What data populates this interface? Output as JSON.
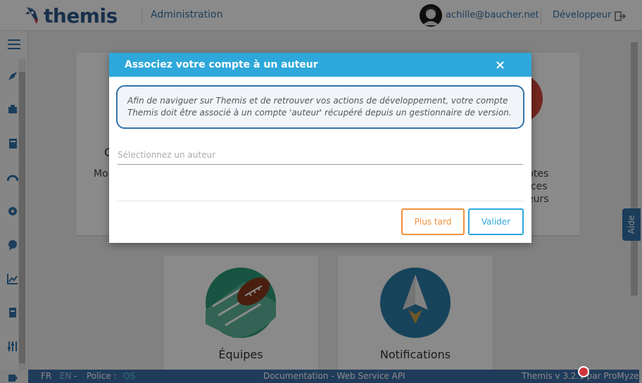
{
  "header": {
    "brand": "themis",
    "section": "Administration",
    "user_email": "achille@baucher.net",
    "profile": "Développeur"
  },
  "sidebar": {
    "icons": [
      "menu-icon",
      "rocket-icon",
      "developer-icon",
      "book-icon",
      "gauge-icon",
      "settings-icon",
      "chat-icon",
      "chart-icon",
      "document-icon",
      "sliders-icon",
      "puzzle-icon"
    ]
  },
  "background_cards": {
    "partial_left_title": "C",
    "partial_left_text": "Mo",
    "partial_right_lines": [
      "ptes",
      "ources",
      "eurs"
    ],
    "teams": "Équipes",
    "notifications": "Notifications"
  },
  "help_tab": "Aide",
  "footer": {
    "lang_fr": "FR",
    "lang_en": "EN",
    "sep1": "-",
    "police_label": "Police :",
    "police_value": "QS",
    "links": "Documentation - Web Service API",
    "version": "Themis v 3.2.1 par ProMyze"
  },
  "modal": {
    "title": "Associez votre compte à un auteur",
    "close": "×",
    "info": "Afin de naviguer sur Themis et de retrouver vos actions de développement, votre compte Themis doit être associé à un compte 'auteur' récupéré depuis un gestionnaire de version.",
    "select_placeholder": "Sélectionnez un auteur",
    "later_button": "Plus tard",
    "validate_button": "Valider"
  },
  "colors": {
    "brand_blue": "#3573a8",
    "modal_header": "#2ea8da",
    "later_orange": "#f0913c",
    "footer_bg": "#3b6fa8",
    "badge_red": "#d0343a"
  }
}
